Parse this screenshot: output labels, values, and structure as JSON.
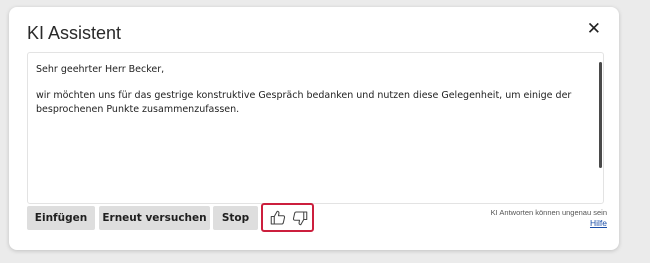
{
  "dialog": {
    "title": "KI Assistent",
    "close_label": "✕"
  },
  "content": {
    "greeting": "Sehr geehrter Herr Becker,",
    "body": "wir möchten uns für das gestrige konstruktive Gespräch bedanken und nutzen diese Gelegenheit, um einige der besprochenen Punkte zusammenzufassen."
  },
  "actions": {
    "insert_label": "Einfügen",
    "retry_label": "Erneut versuchen",
    "stop_label": "Stop"
  },
  "feedback": {
    "thumbs_up_icon": "thumbs-up-icon",
    "thumbs_down_icon": "thumbs-down-icon",
    "highlight_color": "#cc1f3d"
  },
  "footer": {
    "disclaimer": "KI Antworten können ungenau sein",
    "help_link": "Hilfe"
  }
}
